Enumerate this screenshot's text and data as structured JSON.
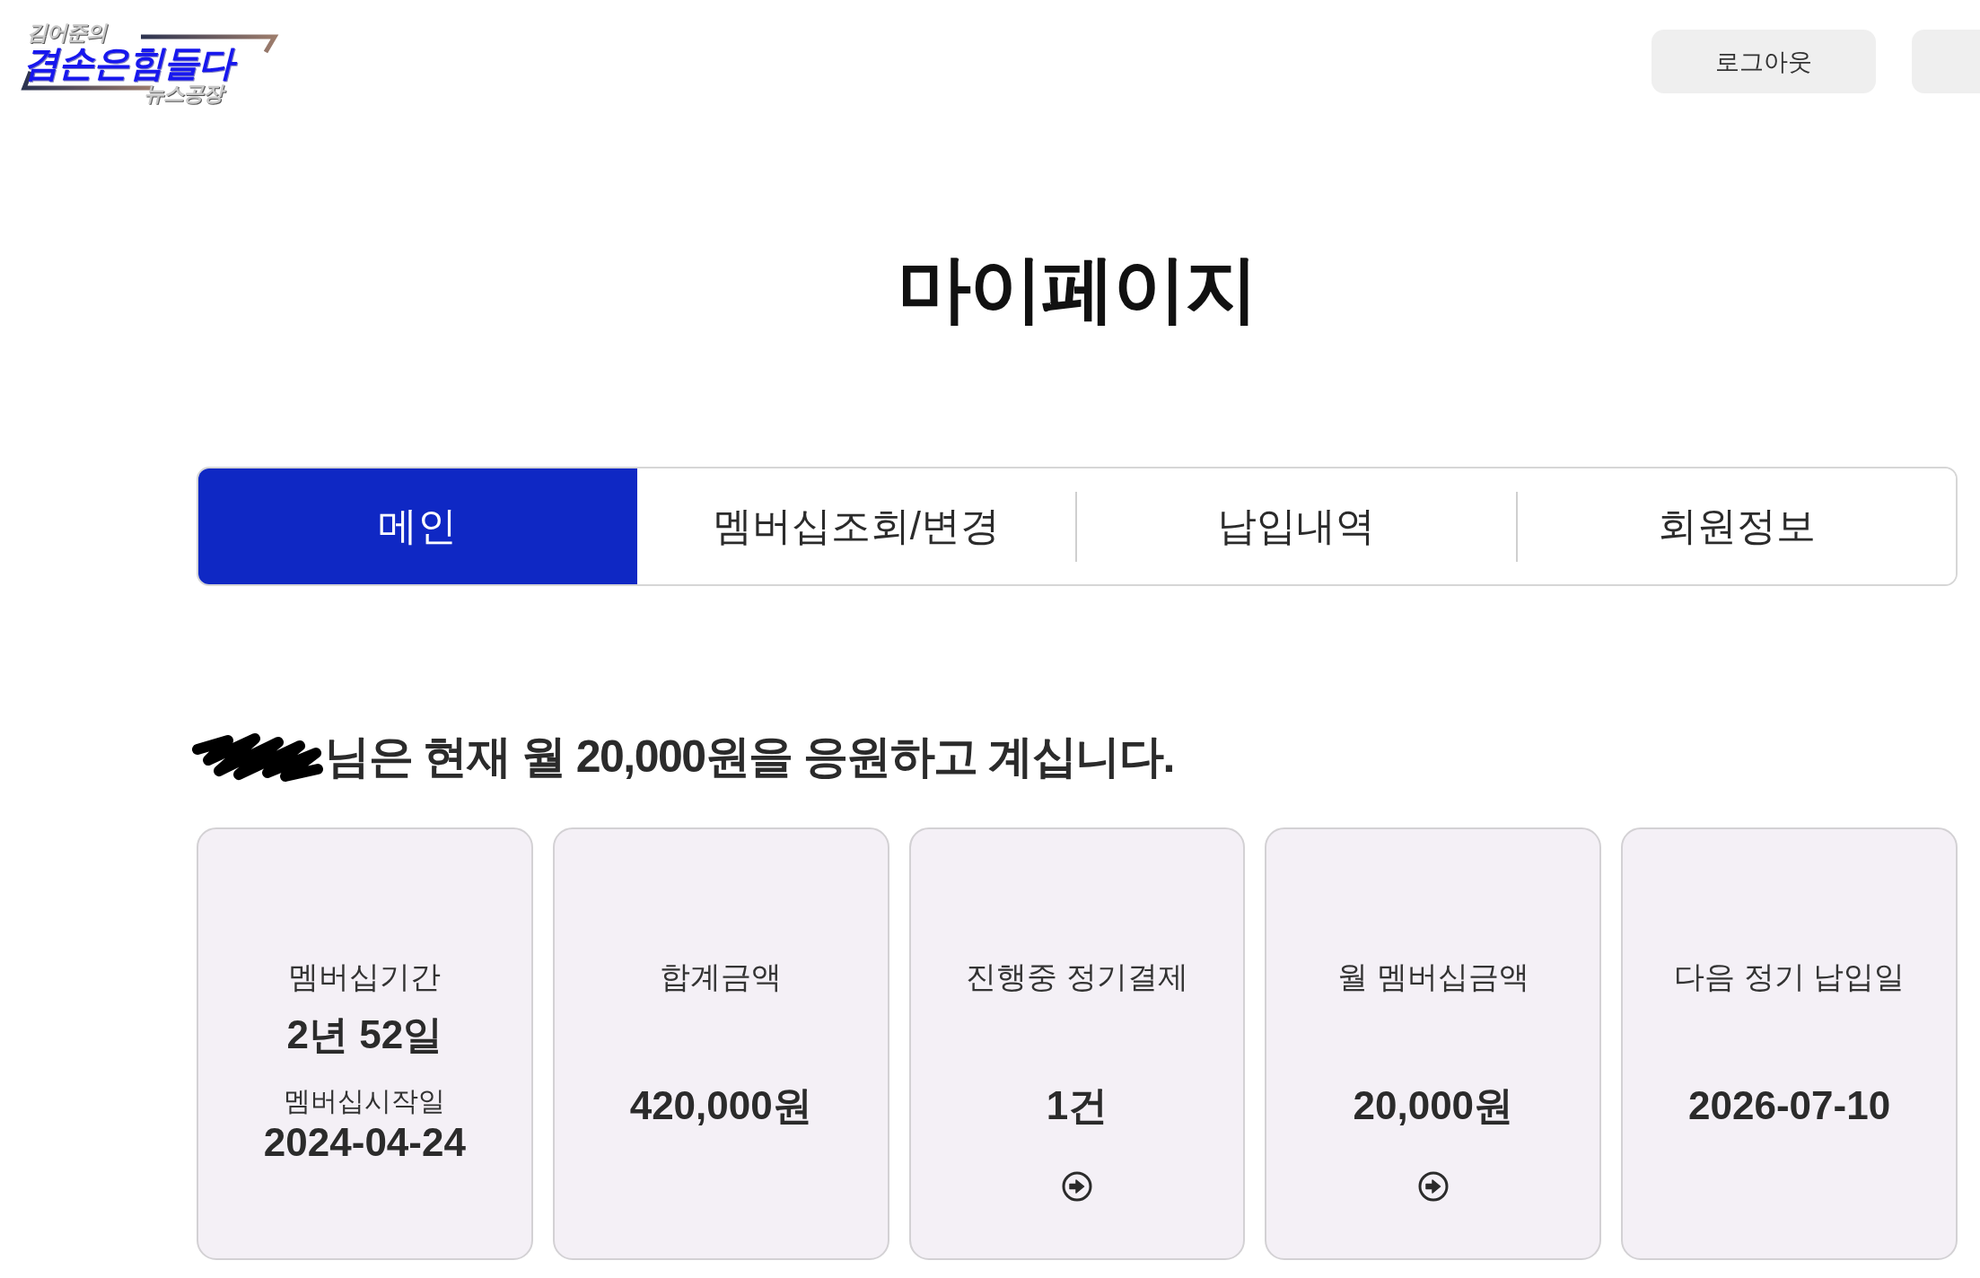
{
  "logo": {
    "tagline": "김어준의",
    "title": "겸손은힘들다",
    "subtitle": "뉴스공장"
  },
  "header": {
    "logout_button": "로그아웃"
  },
  "page_title": "마이페이지",
  "tabs": [
    {
      "label": "메인",
      "selected": true
    },
    {
      "label": "멤버십조회/변경",
      "selected": false
    },
    {
      "label": "납입내역",
      "selected": false
    },
    {
      "label": "회원정보",
      "selected": false
    }
  ],
  "greeting": "님은 현재 월 20,000원을 응원하고 계십니다.",
  "cards": [
    {
      "kind": "period",
      "label": "멤버십기간",
      "value": "2년 52일",
      "sub_label": "멤버십시작일",
      "sub_value": "2024-04-24",
      "link": false
    },
    {
      "kind": "stat",
      "label": "합계금액",
      "value": "420,000원",
      "link": false
    },
    {
      "kind": "stat",
      "label": "진행중 정기결제",
      "value": "1건",
      "link": true
    },
    {
      "kind": "stat",
      "label": "월 멤버십금액",
      "value": "20,000원",
      "link": true
    },
    {
      "kind": "stat",
      "label": "다음 정기 납입일",
      "value": "2026-07-10",
      "link": false
    }
  ]
}
